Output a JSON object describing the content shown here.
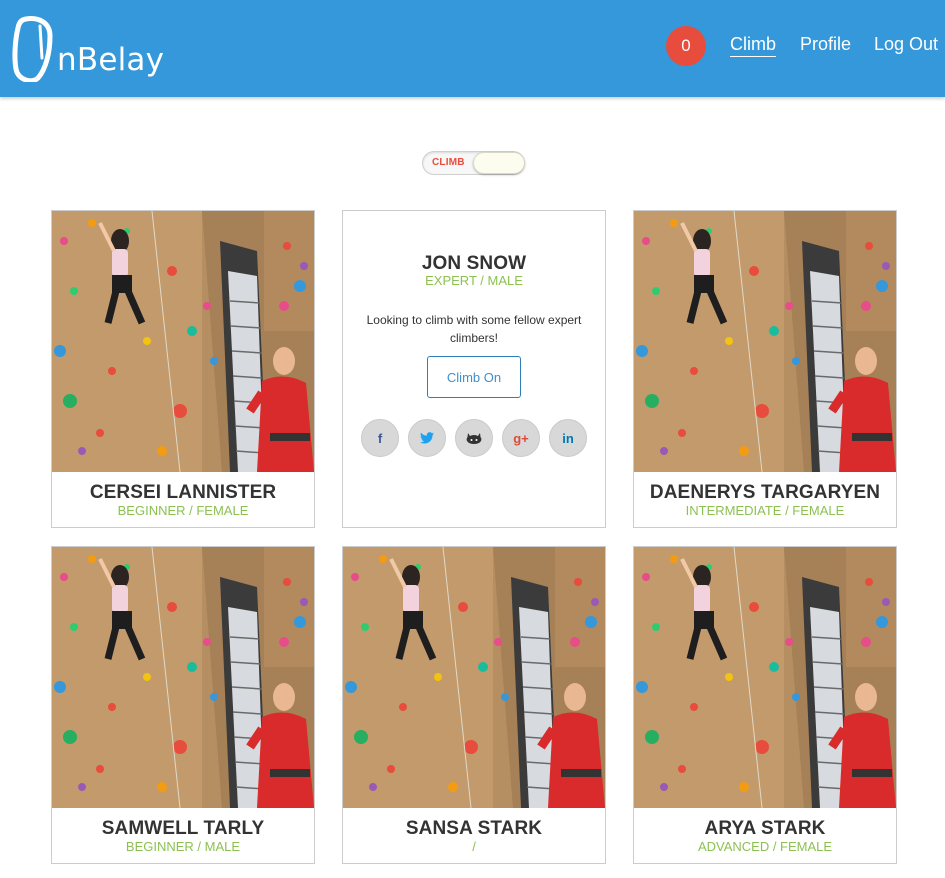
{
  "header": {
    "logo_text": "nBelay",
    "badge_count": "0",
    "nav": {
      "climb": "Climb",
      "profile": "Profile",
      "logout": "Log Out"
    }
  },
  "toggle": {
    "label": "CLIMB"
  },
  "featured": {
    "name": "JON SNOW",
    "meta": "EXPERT / MALE",
    "bio": "Looking to climb with some fellow expert climbers!",
    "button": "Climb On",
    "social": [
      {
        "icon": "facebook-icon",
        "glyph": "f",
        "color": "#3b5998"
      },
      {
        "icon": "twitter-icon",
        "glyph": "🐦",
        "color": "#1da1f2"
      },
      {
        "icon": "github-icon",
        "glyph": "",
        "color": "#333333"
      },
      {
        "icon": "google-plus-icon",
        "glyph": "g+",
        "color": "#dd4b39"
      },
      {
        "icon": "linkedin-icon",
        "glyph": "in",
        "color": "#0077b5"
      }
    ]
  },
  "climbers": [
    {
      "name": "CERSEI LANNISTER",
      "meta": "BEGINNER / FEMALE"
    },
    {
      "name": "DAENERYS TARGARYEN",
      "meta": "INTERMEDIATE / FEMALE"
    },
    {
      "name": "SAMWELL TARLY",
      "meta": "BEGINNER / MALE"
    },
    {
      "name": "SANSA STARK",
      "meta": "/"
    },
    {
      "name": "ARYA STARK",
      "meta": "ADVANCED / FEMALE"
    }
  ],
  "colors": {
    "brand": "#3498db",
    "badge": "#e74c3c",
    "accent_green": "#8cc152"
  }
}
